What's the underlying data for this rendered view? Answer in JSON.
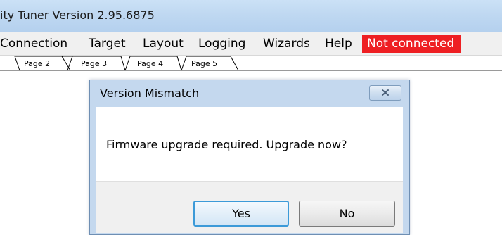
{
  "window": {
    "title": "ity Tuner Version 2.95.6875"
  },
  "menubar": {
    "items": [
      {
        "label": "Connection"
      },
      {
        "label": "Target"
      },
      {
        "label": "Layout"
      },
      {
        "label": "Logging"
      },
      {
        "label": "Wizards"
      },
      {
        "label": "Help"
      }
    ],
    "status": {
      "label": "Not connected",
      "color": "#ee1f23"
    }
  },
  "tabs": [
    {
      "label": "Page 2"
    },
    {
      "label": "Page 3"
    },
    {
      "label": "Page 4"
    },
    {
      "label": "Page 5"
    }
  ],
  "dialog": {
    "title": "Version Mismatch",
    "message": "Firmware upgrade required.  Upgrade now?",
    "buttons": {
      "yes": "Yes",
      "no": "No"
    }
  }
}
